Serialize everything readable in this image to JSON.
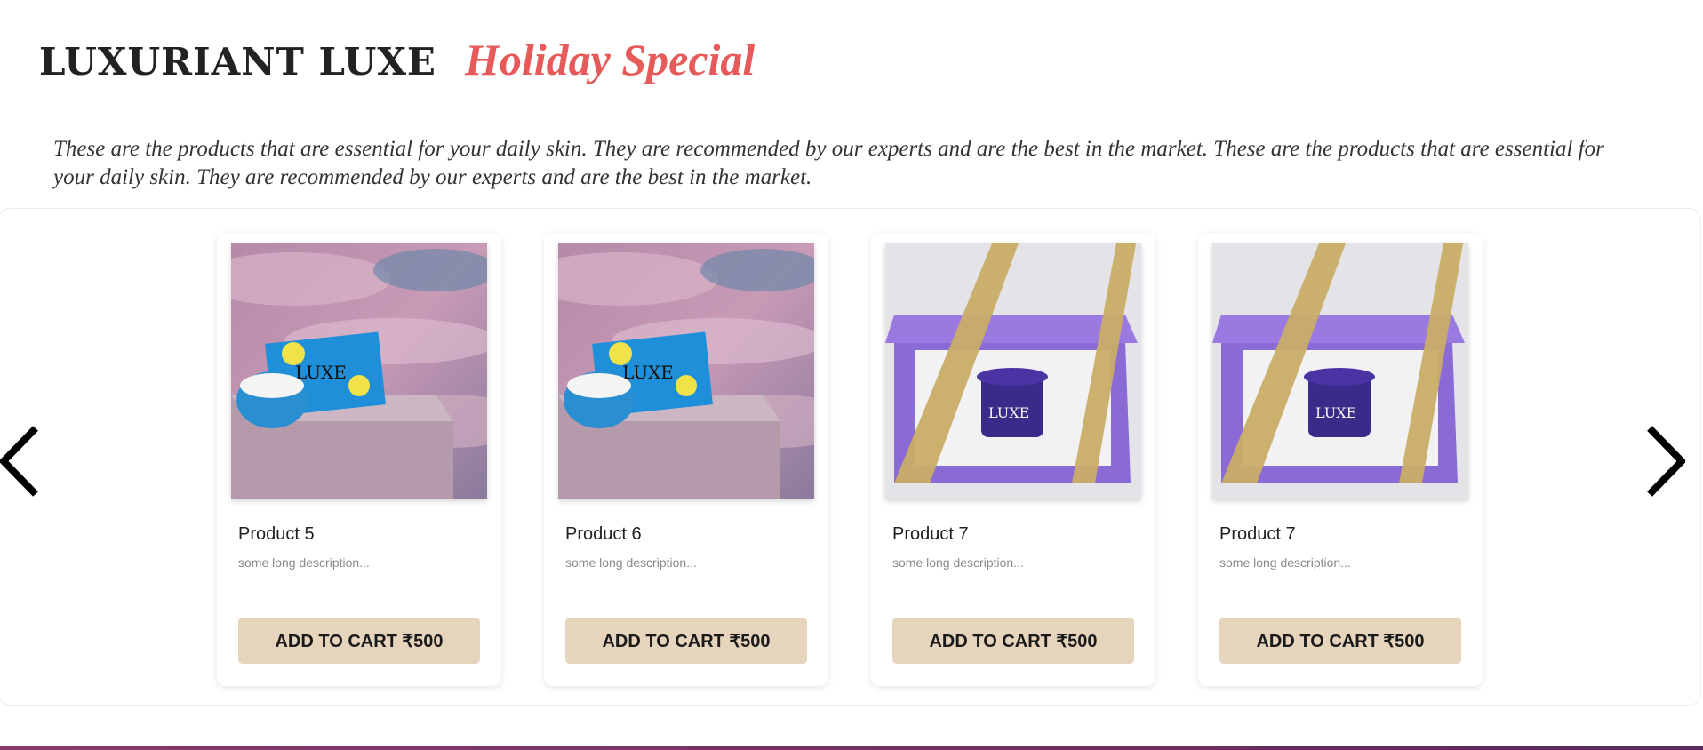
{
  "header": {
    "brand": "LUXURIANT LUXE",
    "subtitle": "Holiday Special",
    "description": "These are the products that are essential for your daily skin. They are recommended by our experts and are the best in the market. These are the products that are essential for your daily skin. They are recommended by our experts and are the best in the market."
  },
  "carousel": {
    "prev_icon": "chevron-left-icon",
    "next_icon": "chevron-right-icon",
    "products": [
      {
        "name": "Product 5",
        "description": "some long description...",
        "button": "ADD TO CART ₹500",
        "image": "blue-gift-box-sky-photo"
      },
      {
        "name": "Product 6",
        "description": "some long description...",
        "button": "ADD TO CART ₹500",
        "image": "blue-gift-box-sky-photo"
      },
      {
        "name": "Product 7",
        "description": "some long description...",
        "button": "ADD TO CART ₹500",
        "image": "purple-gift-box-photo"
      },
      {
        "name": "Product 7",
        "description": "some long description...",
        "button": "ADD TO CART ₹500",
        "image": "purple-gift-box-photo"
      }
    ]
  },
  "colors": {
    "accent": "#e65a5a",
    "button_bg": "#e6d4bc",
    "text": "#222222"
  }
}
